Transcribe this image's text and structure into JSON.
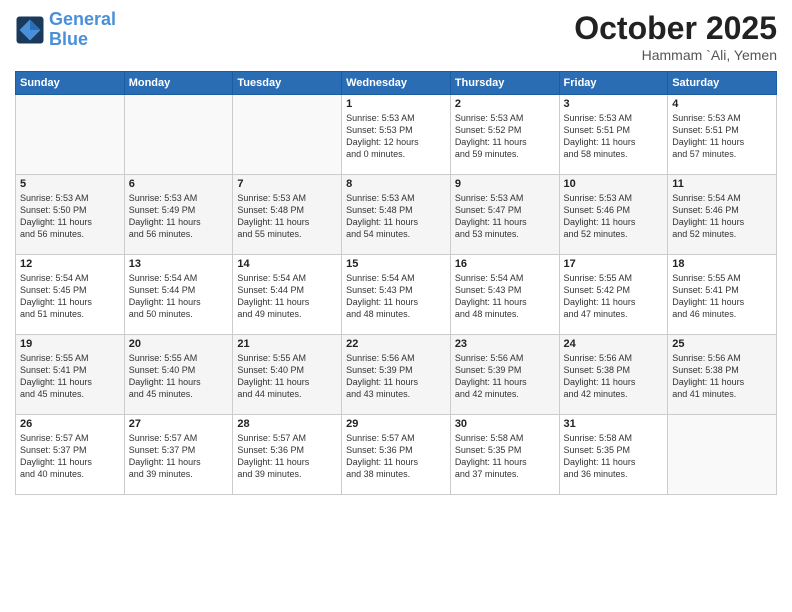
{
  "header": {
    "logo_line1": "General",
    "logo_line2": "Blue",
    "month": "October 2025",
    "location": "Hammam `Ali, Yemen"
  },
  "weekdays": [
    "Sunday",
    "Monday",
    "Tuesday",
    "Wednesday",
    "Thursday",
    "Friday",
    "Saturday"
  ],
  "weeks": [
    [
      {
        "day": "",
        "content": ""
      },
      {
        "day": "",
        "content": ""
      },
      {
        "day": "",
        "content": ""
      },
      {
        "day": "1",
        "content": "Sunrise: 5:53 AM\nSunset: 5:53 PM\nDaylight: 12 hours\nand 0 minutes."
      },
      {
        "day": "2",
        "content": "Sunrise: 5:53 AM\nSunset: 5:52 PM\nDaylight: 11 hours\nand 59 minutes."
      },
      {
        "day": "3",
        "content": "Sunrise: 5:53 AM\nSunset: 5:51 PM\nDaylight: 11 hours\nand 58 minutes."
      },
      {
        "day": "4",
        "content": "Sunrise: 5:53 AM\nSunset: 5:51 PM\nDaylight: 11 hours\nand 57 minutes."
      }
    ],
    [
      {
        "day": "5",
        "content": "Sunrise: 5:53 AM\nSunset: 5:50 PM\nDaylight: 11 hours\nand 56 minutes."
      },
      {
        "day": "6",
        "content": "Sunrise: 5:53 AM\nSunset: 5:49 PM\nDaylight: 11 hours\nand 56 minutes."
      },
      {
        "day": "7",
        "content": "Sunrise: 5:53 AM\nSunset: 5:48 PM\nDaylight: 11 hours\nand 55 minutes."
      },
      {
        "day": "8",
        "content": "Sunrise: 5:53 AM\nSunset: 5:48 PM\nDaylight: 11 hours\nand 54 minutes."
      },
      {
        "day": "9",
        "content": "Sunrise: 5:53 AM\nSunset: 5:47 PM\nDaylight: 11 hours\nand 53 minutes."
      },
      {
        "day": "10",
        "content": "Sunrise: 5:53 AM\nSunset: 5:46 PM\nDaylight: 11 hours\nand 52 minutes."
      },
      {
        "day": "11",
        "content": "Sunrise: 5:54 AM\nSunset: 5:46 PM\nDaylight: 11 hours\nand 52 minutes."
      }
    ],
    [
      {
        "day": "12",
        "content": "Sunrise: 5:54 AM\nSunset: 5:45 PM\nDaylight: 11 hours\nand 51 minutes."
      },
      {
        "day": "13",
        "content": "Sunrise: 5:54 AM\nSunset: 5:44 PM\nDaylight: 11 hours\nand 50 minutes."
      },
      {
        "day": "14",
        "content": "Sunrise: 5:54 AM\nSunset: 5:44 PM\nDaylight: 11 hours\nand 49 minutes."
      },
      {
        "day": "15",
        "content": "Sunrise: 5:54 AM\nSunset: 5:43 PM\nDaylight: 11 hours\nand 48 minutes."
      },
      {
        "day": "16",
        "content": "Sunrise: 5:54 AM\nSunset: 5:43 PM\nDaylight: 11 hours\nand 48 minutes."
      },
      {
        "day": "17",
        "content": "Sunrise: 5:55 AM\nSunset: 5:42 PM\nDaylight: 11 hours\nand 47 minutes."
      },
      {
        "day": "18",
        "content": "Sunrise: 5:55 AM\nSunset: 5:41 PM\nDaylight: 11 hours\nand 46 minutes."
      }
    ],
    [
      {
        "day": "19",
        "content": "Sunrise: 5:55 AM\nSunset: 5:41 PM\nDaylight: 11 hours\nand 45 minutes."
      },
      {
        "day": "20",
        "content": "Sunrise: 5:55 AM\nSunset: 5:40 PM\nDaylight: 11 hours\nand 45 minutes."
      },
      {
        "day": "21",
        "content": "Sunrise: 5:55 AM\nSunset: 5:40 PM\nDaylight: 11 hours\nand 44 minutes."
      },
      {
        "day": "22",
        "content": "Sunrise: 5:56 AM\nSunset: 5:39 PM\nDaylight: 11 hours\nand 43 minutes."
      },
      {
        "day": "23",
        "content": "Sunrise: 5:56 AM\nSunset: 5:39 PM\nDaylight: 11 hours\nand 42 minutes."
      },
      {
        "day": "24",
        "content": "Sunrise: 5:56 AM\nSunset: 5:38 PM\nDaylight: 11 hours\nand 42 minutes."
      },
      {
        "day": "25",
        "content": "Sunrise: 5:56 AM\nSunset: 5:38 PM\nDaylight: 11 hours\nand 41 minutes."
      }
    ],
    [
      {
        "day": "26",
        "content": "Sunrise: 5:57 AM\nSunset: 5:37 PM\nDaylight: 11 hours\nand 40 minutes."
      },
      {
        "day": "27",
        "content": "Sunrise: 5:57 AM\nSunset: 5:37 PM\nDaylight: 11 hours\nand 39 minutes."
      },
      {
        "day": "28",
        "content": "Sunrise: 5:57 AM\nSunset: 5:36 PM\nDaylight: 11 hours\nand 39 minutes."
      },
      {
        "day": "29",
        "content": "Sunrise: 5:57 AM\nSunset: 5:36 PM\nDaylight: 11 hours\nand 38 minutes."
      },
      {
        "day": "30",
        "content": "Sunrise: 5:58 AM\nSunset: 5:35 PM\nDaylight: 11 hours\nand 37 minutes."
      },
      {
        "day": "31",
        "content": "Sunrise: 5:58 AM\nSunset: 5:35 PM\nDaylight: 11 hours\nand 36 minutes."
      },
      {
        "day": "",
        "content": ""
      }
    ]
  ]
}
